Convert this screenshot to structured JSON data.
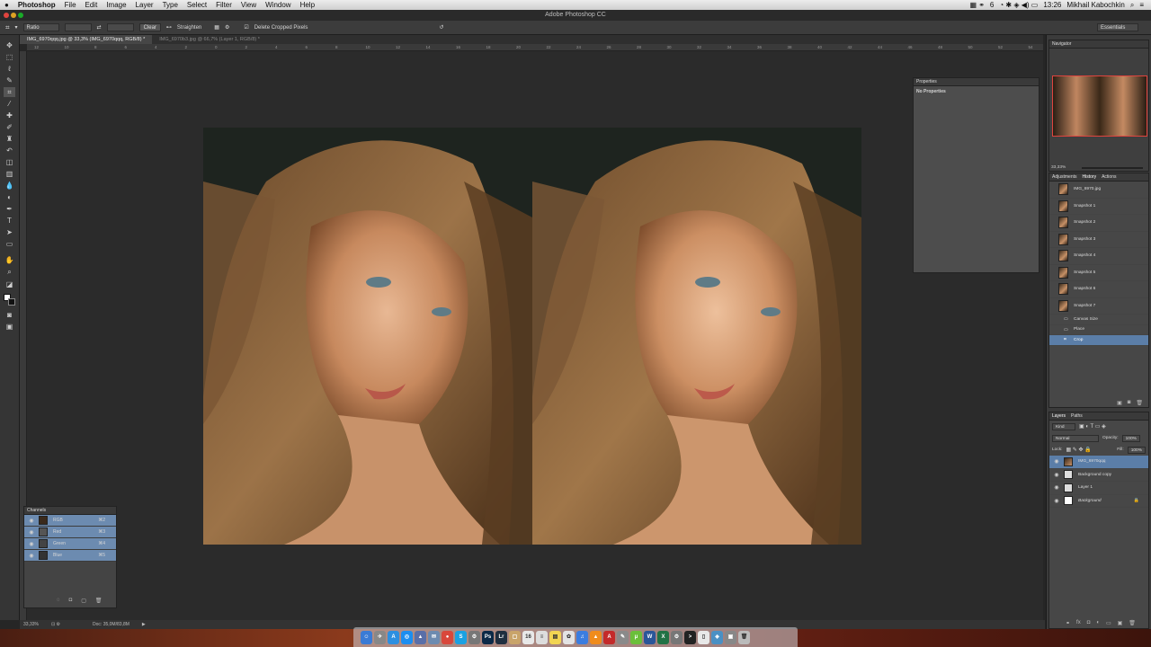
{
  "menubar": {
    "apple": "",
    "app": "Photoshop",
    "items": [
      "File",
      "Edit",
      "Image",
      "Layer",
      "Type",
      "Select",
      "Filter",
      "View",
      "Window",
      "Help"
    ],
    "right": {
      "battery": "6",
      "clock": "13:26",
      "user": "Mikhail Kabochkin"
    }
  },
  "window": {
    "title": "Adobe Photoshop CC"
  },
  "options": {
    "ratio": "Ratio",
    "clear": "Clear",
    "straighten": "Straighten",
    "delete_cropped": "Delete Cropped Pixels",
    "workspace": "Essentials"
  },
  "tabs": [
    {
      "label": "IMG_6970qqq.jpg @ 33,3% (IMG_6970qqq, RGB/8) *",
      "active": true
    },
    {
      "label": "IMG_6970b3.jpg @ 66,7% (Layer 1, RGB/8) *",
      "active": false
    }
  ],
  "ruler": {
    "ticks": [
      "12",
      "10",
      "8",
      "6",
      "4",
      "2",
      "0",
      "2",
      "4",
      "6",
      "8",
      "10",
      "12",
      "14",
      "16",
      "18",
      "20",
      "22",
      "24",
      "26",
      "28",
      "30",
      "32",
      "34",
      "36",
      "38",
      "40",
      "42",
      "44",
      "46",
      "48",
      "50",
      "52",
      "54",
      "56",
      "58"
    ]
  },
  "properties": {
    "title": "Properties",
    "empty": "No Properties"
  },
  "channels": {
    "title": "Channels",
    "rows": [
      {
        "name": "RGB",
        "shortcut": "⌘2"
      },
      {
        "name": "Red",
        "shortcut": "⌘3"
      },
      {
        "name": "Green",
        "shortcut": "⌘4"
      },
      {
        "name": "Blue",
        "shortcut": "⌘5"
      }
    ]
  },
  "navigator": {
    "title": "Navigator",
    "zoom": "33,33%"
  },
  "history": {
    "tabs": [
      "Adjustments",
      "History",
      "Actions"
    ],
    "source": "IMG_6970.jpg",
    "snapshots": [
      "Snapshot 1",
      "Snapshot 2",
      "Snapshot 3",
      "Snapshot 4",
      "Snapshot 5",
      "Snapshot 6",
      "Snapshot 7"
    ],
    "steps": [
      "Canvas Size",
      "Place",
      "Crop"
    ]
  },
  "layers": {
    "tabs": [
      "Layers",
      "Paths"
    ],
    "kind": "Kind",
    "blend": "Normal",
    "opacity_label": "Opacity:",
    "opacity": "100%",
    "lock_label": "Lock:",
    "fill_label": "Fill:",
    "fill": "100%",
    "rows": [
      {
        "name": "IMG_6970qqq",
        "active": true
      },
      {
        "name": "Background copy",
        "active": false
      },
      {
        "name": "Layer 1",
        "active": false
      },
      {
        "name": "Background",
        "active": false
      }
    ]
  },
  "status": {
    "zoom": "33,33%",
    "doc": "Doc: 35,0M/83,8M"
  },
  "dock": {
    "icons": [
      {
        "name": "finder-icon",
        "color": "#3a7bd5",
        "glyph": "☺"
      },
      {
        "name": "launchpad-icon",
        "color": "#888",
        "glyph": "✈"
      },
      {
        "name": "app-store-icon",
        "color": "#2d8fe0",
        "glyph": "A"
      },
      {
        "name": "safari-icon",
        "color": "#1c8ef0",
        "glyph": "◎"
      },
      {
        "name": "preview-icon",
        "color": "#5a6fa8",
        "glyph": "▲"
      },
      {
        "name": "mail-icon",
        "color": "#6d8bb0",
        "glyph": "✉"
      },
      {
        "name": "chrome-icon",
        "color": "#d9483b",
        "glyph": "●"
      },
      {
        "name": "skype-icon",
        "color": "#1ba1e2",
        "glyph": "S"
      },
      {
        "name": "system-preferences-icon",
        "color": "#777",
        "glyph": "⚙"
      },
      {
        "name": "photoshop-icon",
        "color": "#0b2947",
        "glyph": "Ps"
      },
      {
        "name": "lightroom-icon",
        "color": "#1f2e3f",
        "glyph": "Lr"
      },
      {
        "name": "folder-icon",
        "color": "#c9a46a",
        "glyph": "▢"
      },
      {
        "name": "calendar-icon",
        "color": "#e8e8e8",
        "glyph": "16"
      },
      {
        "name": "textedit-icon",
        "color": "#ddd",
        "glyph": "≡"
      },
      {
        "name": "notes-icon",
        "color": "#f2d552",
        "glyph": "▤"
      },
      {
        "name": "photos-icon",
        "color": "#e3e3e3",
        "glyph": "✿"
      },
      {
        "name": "itunes-icon",
        "color": "#3b7de0",
        "glyph": "♫"
      },
      {
        "name": "vlc-icon",
        "color": "#f08c1c",
        "glyph": "▲"
      },
      {
        "name": "adobe-icon",
        "color": "#c42a2a",
        "glyph": "A"
      },
      {
        "name": "script-editor-icon",
        "color": "#8a8a8a",
        "glyph": "✎"
      },
      {
        "name": "utorrent-icon",
        "color": "#6bbf3a",
        "glyph": "μ"
      },
      {
        "name": "word-icon",
        "color": "#2a5699",
        "glyph": "W"
      },
      {
        "name": "excel-icon",
        "color": "#207245",
        "glyph": "X"
      },
      {
        "name": "automator-icon",
        "color": "#777",
        "glyph": "⚙"
      },
      {
        "name": "terminal-icon",
        "color": "#222",
        "glyph": ">"
      },
      {
        "name": "docs-icon",
        "color": "#e8e8e8",
        "glyph": "▯"
      },
      {
        "name": "maps-icon",
        "color": "#4a90c4",
        "glyph": "◈"
      },
      {
        "name": "screenshot-icon",
        "color": "#888",
        "glyph": "▣"
      },
      {
        "name": "trash-icon",
        "color": "#bbb",
        "glyph": "🗑"
      }
    ]
  }
}
